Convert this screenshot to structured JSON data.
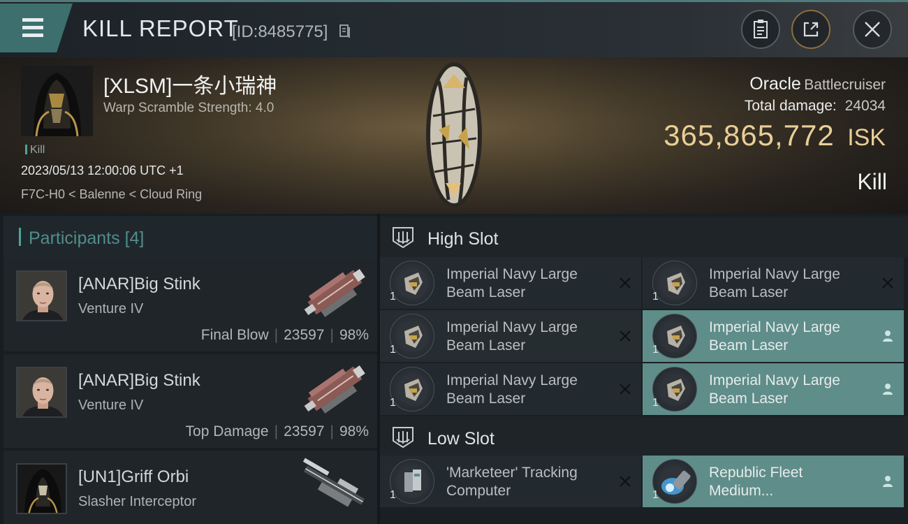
{
  "header": {
    "title": "KILL REPORT",
    "report_id": "[ID:8485775]",
    "icons": [
      "menu-icon",
      "copy-icon",
      "clipboard-icon",
      "share-icon",
      "close-icon"
    ]
  },
  "victim": {
    "name": "[XLSM]一条小瑞神",
    "warp_scramble": "Warp Scramble Strength: 4.0",
    "result_tag": "Kill",
    "datetime": "2023/05/13 12:00:06 UTC +1",
    "location": "F7C-H0 < Balenne < Cloud Ring",
    "ship_name": "Oracle",
    "ship_class": "Battlecruiser",
    "total_damage_label": "Total damage:",
    "total_damage": "24034",
    "isk_value": "365,865,772",
    "isk_unit": "ISK",
    "result": "Kill"
  },
  "participants": {
    "title": "Participants",
    "count": "[4]",
    "rows": [
      {
        "name": "[ANAR]Big Stink",
        "ship": "Venture IV",
        "role": "Final Blow",
        "damage": "23597",
        "percent": "98%"
      },
      {
        "name": "[ANAR]Big Stink",
        "ship": "Venture IV",
        "role": "Top Damage",
        "damage": "23597",
        "percent": "98%"
      },
      {
        "name": "[UN1]Griff Orbi",
        "ship": "Slasher Interceptor",
        "role": "",
        "damage": "",
        "percent": ""
      }
    ]
  },
  "slots": {
    "high": {
      "label": "High Slot",
      "modules": [
        {
          "qty": "1",
          "line1": "Imperial Navy Large",
          "line2": "Beam Laser",
          "status": "destroyed"
        },
        {
          "qty": "1",
          "line1": "Imperial Navy Large",
          "line2": "Beam Laser",
          "status": "destroyed"
        },
        {
          "qty": "1",
          "line1": "Imperial Navy Large",
          "line2": "Beam Laser",
          "status": "destroyed"
        },
        {
          "qty": "1",
          "line1": "Imperial Navy Large",
          "line2": "Beam Laser",
          "status": "dropped"
        },
        {
          "qty": "1",
          "line1": "Imperial Navy Large",
          "line2": "Beam Laser",
          "status": "destroyed"
        },
        {
          "qty": "1",
          "line1": "Imperial Navy Large",
          "line2": "Beam Laser",
          "status": "dropped"
        }
      ]
    },
    "low": {
      "label": "Low Slot",
      "modules": [
        {
          "qty": "1",
          "line1": "'Marketeer' Tracking",
          "line2": "Computer",
          "status": "destroyed"
        },
        {
          "qty": "1",
          "line1": "Republic Fleet",
          "line2": "Medium...",
          "status": "dropped"
        }
      ]
    }
  },
  "colors": {
    "accent_teal": "#4fa39a",
    "dropped_bg": "#5f8d89",
    "isk_gold": "#e9cf96"
  }
}
